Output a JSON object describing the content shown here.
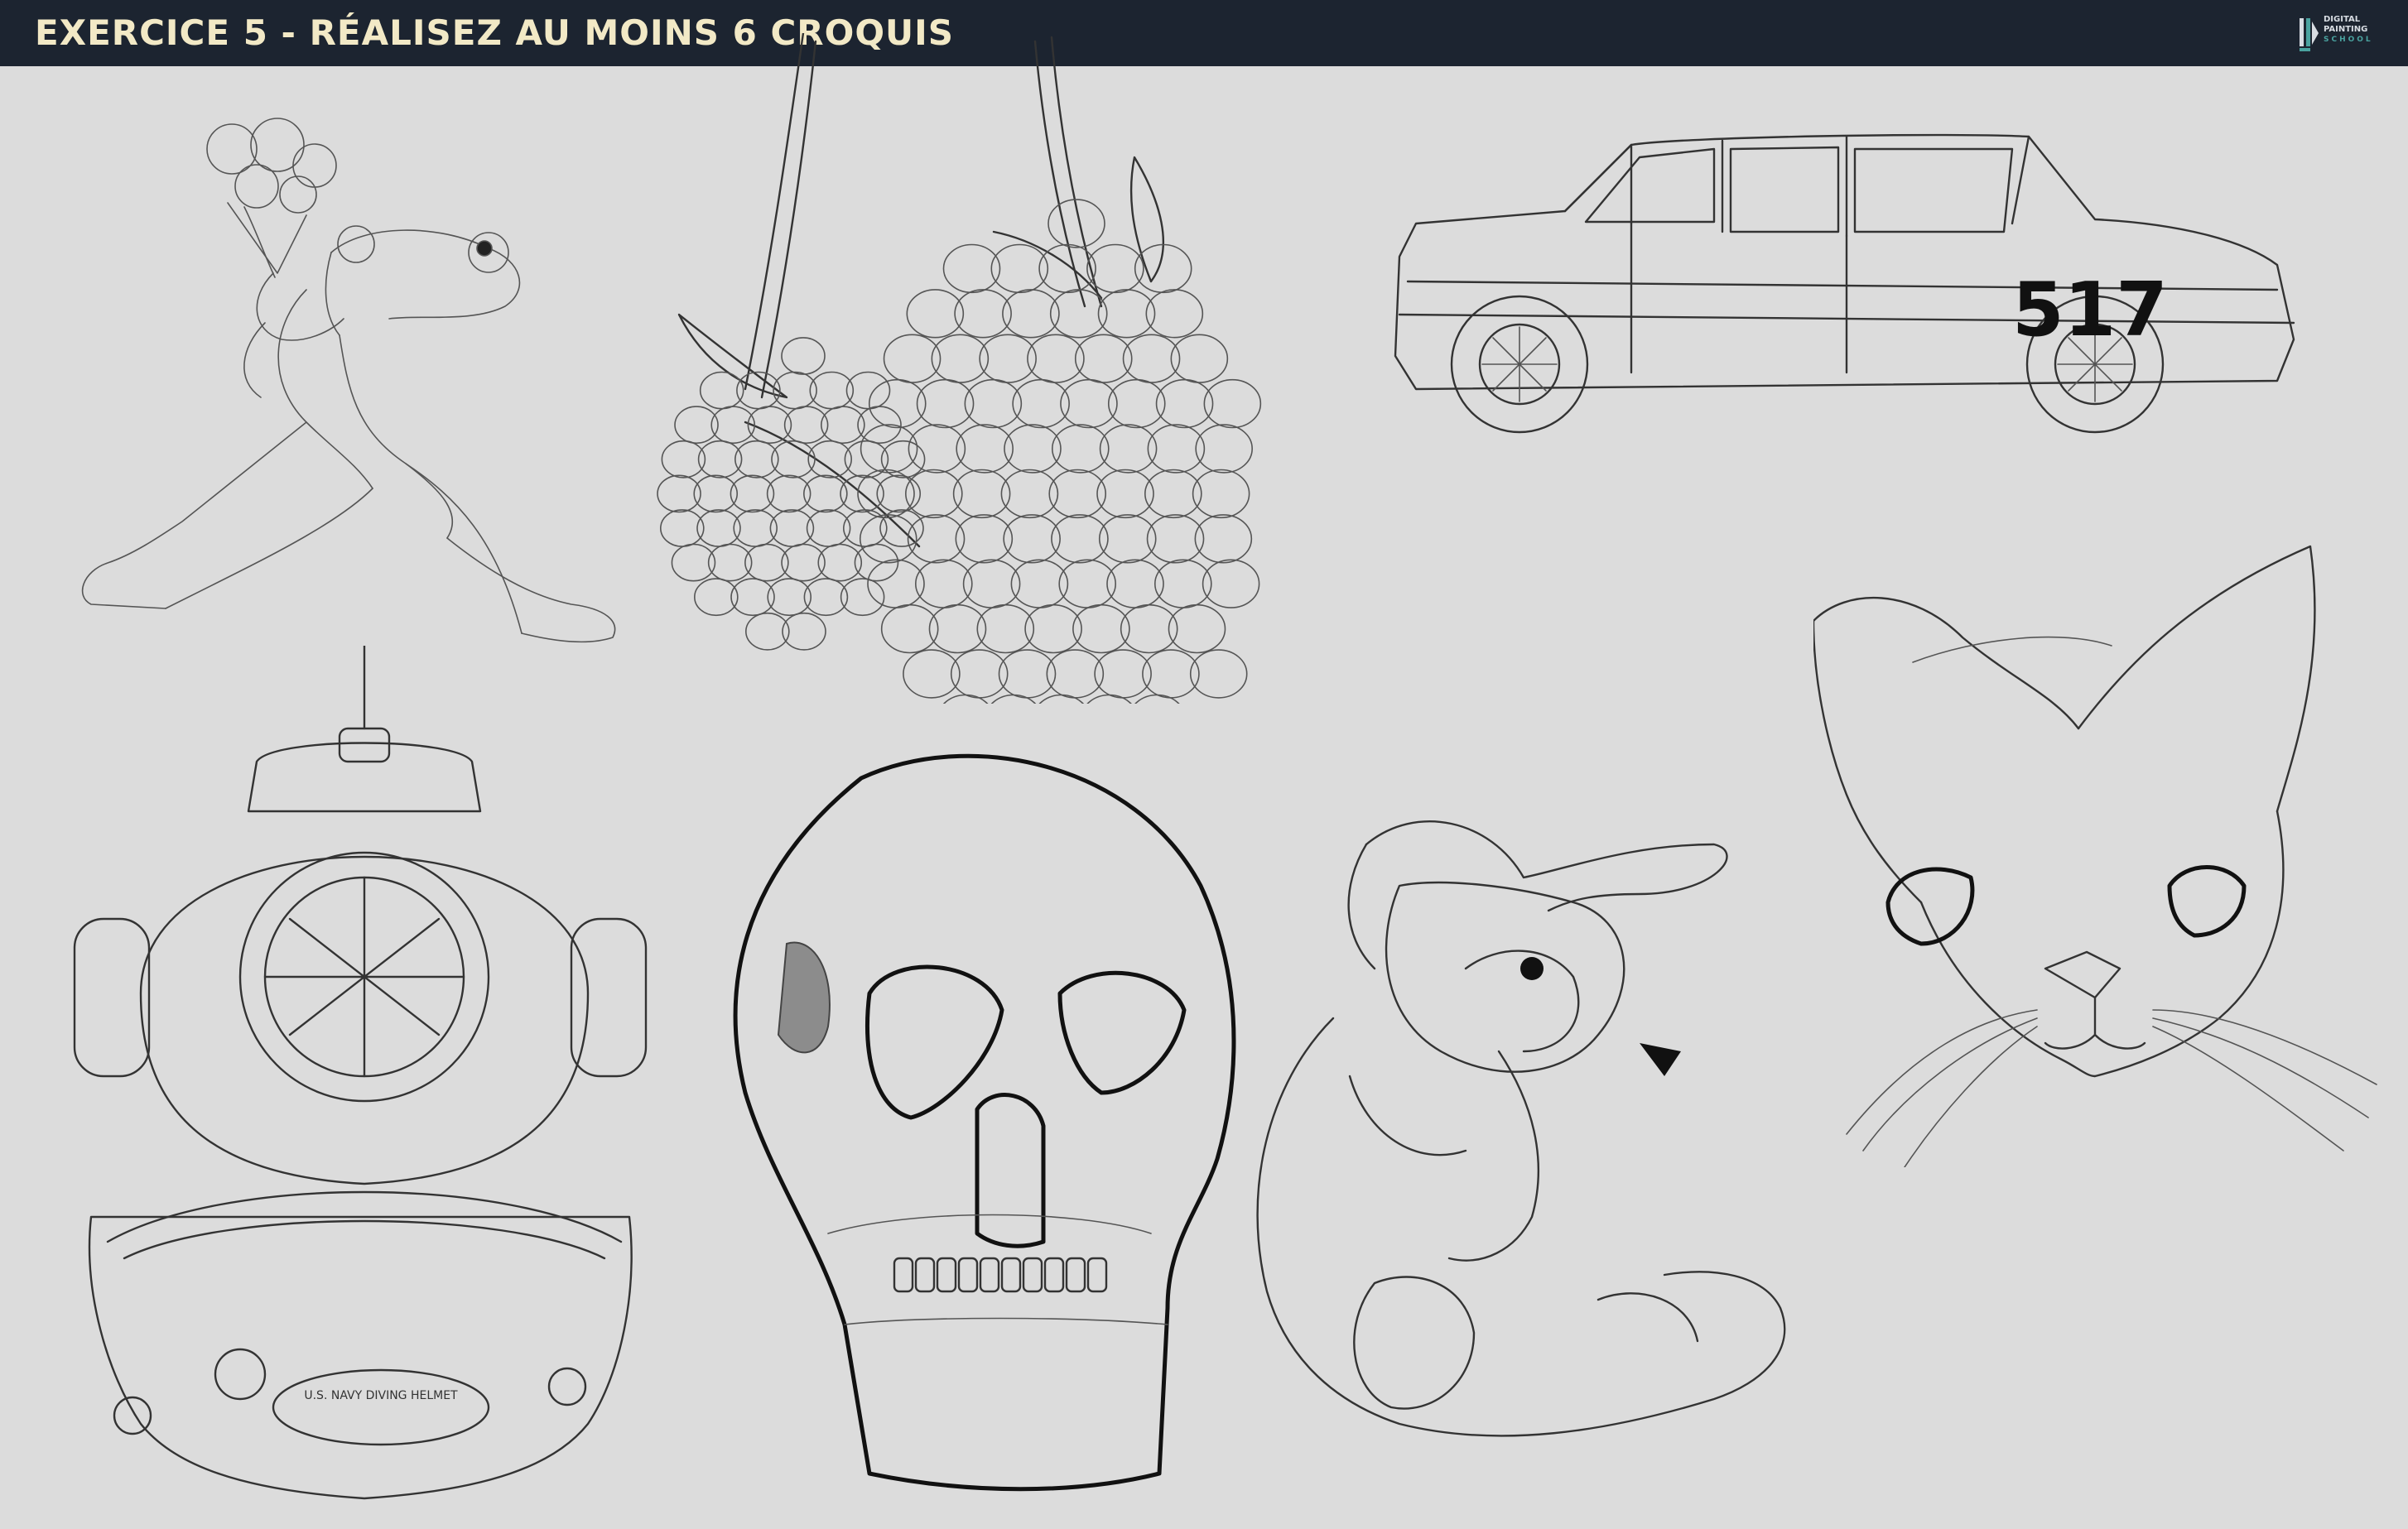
{
  "header": {
    "title": "EXERCICE 5 - RÉALISEZ AU MOINS 6 CROQUIS",
    "background": "#1c2430",
    "title_color": "#f2e9c6"
  },
  "logo": {
    "line1": "DIGITAL",
    "line2": "PAINTING",
    "line3": "SCHOOL",
    "accent": "#4aa3a0"
  },
  "sketches": {
    "frog": {
      "icon": "frog-with-bouquet-sketch"
    },
    "raspberries": {
      "icon": "raspberries-sketch"
    },
    "car": {
      "icon": "car-sketch",
      "race_number": "517"
    },
    "diving_helmet": {
      "icon": "diving-helmet-sketch",
      "plate_text": "U.S. NAVY DIVING HELMET"
    },
    "skull": {
      "icon": "skull-sketch"
    },
    "rabbit": {
      "icon": "plush-rabbit-sketch"
    },
    "cat": {
      "icon": "cat-head-sketch"
    }
  },
  "canvas_background": "#dcdcdc"
}
